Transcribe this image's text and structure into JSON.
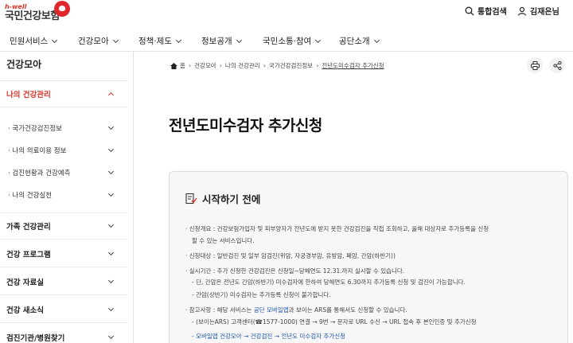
{
  "header": {
    "logo_small": "h-well",
    "logo_main": "국민건강보험",
    "search_label": "통합검색",
    "user_label": "김재은님"
  },
  "gnb": {
    "items": [
      "민원서비스",
      "건강모아",
      "정책·제도",
      "정보공개",
      "국민소통·참여",
      "공단소개"
    ]
  },
  "sidebar": {
    "title": "건강모아",
    "active_section": "나의 건강관리",
    "sub_items": [
      "국가건강검진정보",
      "나의 의료이용 정보",
      "검진현황과 건강예측",
      "나의 건강실천"
    ],
    "sections": [
      "가족 건강관리",
      "건강 프로그램",
      "건강 자료실",
      "건강 새소식",
      "검진기관/병원찾기"
    ]
  },
  "breadcrumb": {
    "home": "홈",
    "items": [
      "건강모아",
      "나의 건강관리",
      "국가건강검진정보"
    ],
    "current": "전년도미수검자 추가신청"
  },
  "page": {
    "title": "전년도미수검자 추가신청"
  },
  "notice": {
    "title": "시작하기 전에",
    "overview_1": "· 신청개요 : 건강보험가입자 및 피부양자가 전년도에 받지 못한 건강검진을 직접 조회하고, 올해 대상자로 추가등록을 신청",
    "overview_2": "할 수 있는 서비스입니다.",
    "target": "· 신청대상 : 일반검진 및 일부 암검진(위암, 자궁경부암, 유방암, 폐암, 간암(하반기))",
    "period": "· 실시기간 : 추가 신청한 건강검진은 신청일~당해연도 12.31.까지 실시할 수 있습니다.",
    "period_note_1": "- 단, 간암은 전년도 간암(하반기) 미수검자에 한하여 당해연도 6.30까지 추가등록 신청 및 검진이 가능합니다.",
    "period_note_2": "- 간암(상반기) 미수검자는 추가등록 신청이 불가합니다.",
    "ref_prefix": "· 참고사항 : 해당 서비스는 ",
    "ref_link": "공단 모바일앱",
    "ref_suffix": "과 보이는 ARS를 통해서도 신청할 수 있습니다.",
    "ars": "- (보이는ARS) 고객센터(☎1577-1000) 연결 → 9번 → 문자로 URL 수신 → URL 접속 후 본인인증 및 추가신청",
    "app_path": "- 모바일앱 건강모아 → 건강검진 → 전년도 미수검자 추가신청"
  },
  "colors": {
    "accent": "#d9352b",
    "link": "#1a55b4"
  }
}
